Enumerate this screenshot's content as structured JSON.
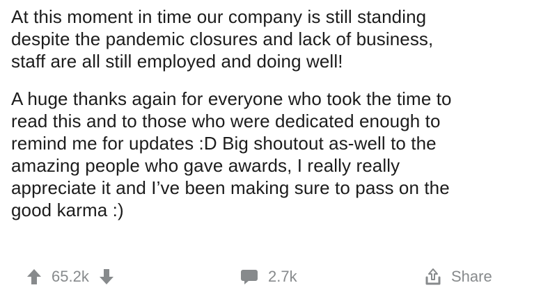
{
  "post": {
    "paragraphs": [
      "At this moment in time our company is still standing\ndespite the pandemic closures and lack of business,\nstaff are all still employed and doing well!",
      "A huge thanks again for everyone who took the time to\nread this and to those who were dedicated enough to\nremind me for updates :D Big shoutout as-well to the\namazing people who gave awards, I really really\nappreciate it and I’ve been making sure to pass on the\ngood karma :)"
    ]
  },
  "actions": {
    "vote_count": "65.2k",
    "comment_count": "2.7k",
    "share_label": "Share",
    "icons": {
      "upvote": "arrow-up-icon",
      "downvote": "arrow-down-icon",
      "comments": "comment-bubble-icon",
      "share": "share-icon"
    },
    "icon_color": "#878a8c"
  }
}
